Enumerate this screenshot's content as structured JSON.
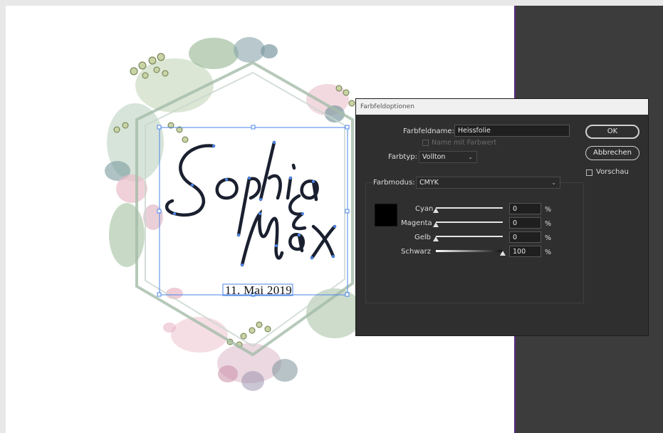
{
  "document": {
    "headline": "Sophia & Max",
    "date_text": "11. Mai 2019"
  },
  "dialog": {
    "title": "Farbfeldoptionen",
    "name_label": "Farbfeldname:",
    "name_value": "Heissfolie",
    "name_with_value_label": "Name mit Farbwert",
    "name_with_value_checked": false,
    "type_label": "Farbtyp:",
    "type_value": "Vollton",
    "mode_label": "Farbmodus:",
    "mode_value": "CMYK",
    "ok_label": "OK",
    "cancel_label": "Abbrechen",
    "preview_label": "Vorschau",
    "preview_checked": false,
    "swatch_color": "#000000",
    "percent_sign": "%",
    "channels": [
      {
        "label": "Cyan",
        "value": "0",
        "level": 0
      },
      {
        "label": "Magenta",
        "value": "0",
        "level": 0
      },
      {
        "label": "Gelb",
        "value": "0",
        "level": 0
      },
      {
        "label": "Schwarz",
        "value": "100",
        "level": 100
      }
    ]
  },
  "colors": {
    "page": "#ffffff",
    "pasteboard": "#3c3c3c",
    "selection": "#4a86e8",
    "frame": "#9fb8a7"
  }
}
